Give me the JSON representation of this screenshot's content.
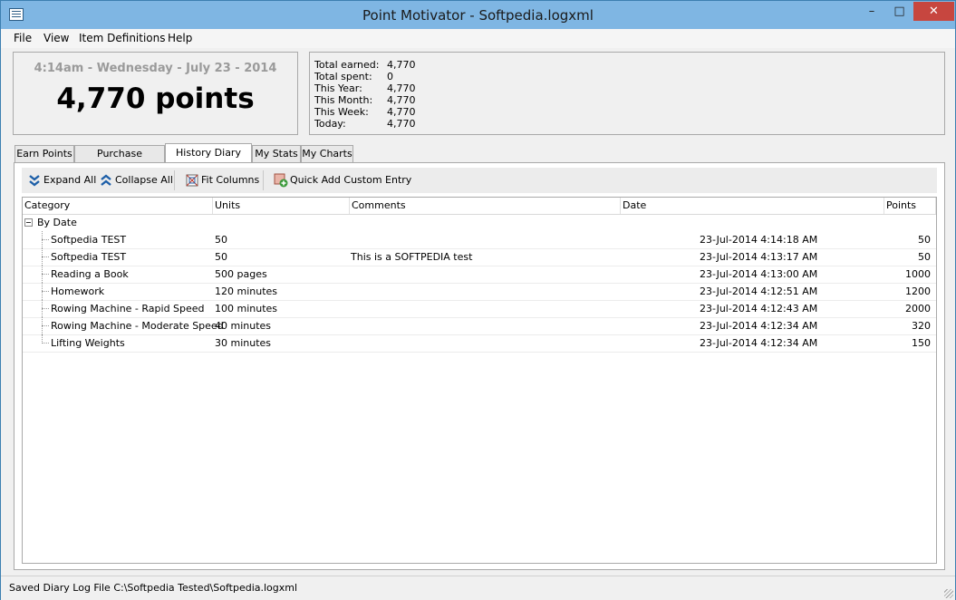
{
  "window": {
    "title": "Point Motivator - Softpedia.logxml",
    "minimize_glyph": "–",
    "maximize_glyph": "□",
    "close_glyph": "✕",
    "icon": "app-icon"
  },
  "menu": {
    "file": "File",
    "view": "View",
    "item_definitions": "Item Definitions",
    "help": "Help"
  },
  "summary": {
    "datetime": "4:14am - Wednesday - July 23 - 2014",
    "points": "4,770 points",
    "totals": [
      {
        "label": "Total earned:",
        "value": "4,770"
      },
      {
        "label": "Total spent:",
        "value": "0"
      },
      {
        "label": "This Year:",
        "value": "4,770"
      },
      {
        "label": "This Month:",
        "value": "4,770"
      },
      {
        "label": "This Week:",
        "value": "4,770"
      },
      {
        "label": "Today:",
        "value": "4,770"
      }
    ]
  },
  "tabs": [
    {
      "label": "Earn Points",
      "active": false
    },
    {
      "label": "Purchase Rewards",
      "active": false
    },
    {
      "label": "History Diary Log",
      "active": true
    },
    {
      "label": "My Stats",
      "active": false
    },
    {
      "label": "My Charts",
      "active": false
    }
  ],
  "toolbar": {
    "expand_all": "Expand All",
    "collapse_all": "Collapse All",
    "fit_columns": "Fit Columns",
    "quick_add": "Quick Add Custom Entry",
    "colors": {
      "chevron": "#1d5fa8",
      "add": "#3c9a3c"
    }
  },
  "grid": {
    "columns": [
      "Category",
      "Units",
      "Comments",
      "Date",
      "Points"
    ],
    "group": "By Date",
    "rows": [
      {
        "category": "Softpedia TEST",
        "units": "50",
        "comments": "",
        "date": "23-Jul-2014 4:14:18 AM",
        "points": "50"
      },
      {
        "category": "Softpedia TEST",
        "units": "50",
        "comments": "This is a SOFTPEDIA test",
        "date": "23-Jul-2014 4:13:17 AM",
        "points": "50"
      },
      {
        "category": "Reading a Book",
        "units": "500 pages",
        "comments": "",
        "date": "23-Jul-2014 4:13:00 AM",
        "points": "1000"
      },
      {
        "category": "Homework",
        "units": "120 minutes",
        "comments": "",
        "date": "23-Jul-2014 4:12:51 AM",
        "points": "1200"
      },
      {
        "category": "Rowing Machine - Rapid Speed",
        "units": "100 minutes",
        "comments": "",
        "date": "23-Jul-2014 4:12:43 AM",
        "points": "2000"
      },
      {
        "category": "Rowing Machine - Moderate Speed",
        "units": "40 minutes",
        "comments": "",
        "date": "23-Jul-2014 4:12:34 AM",
        "points": "320"
      },
      {
        "category": "Lifting Weights",
        "units": "30 minutes",
        "comments": "",
        "date": "23-Jul-2014 4:12:34 AM",
        "points": "150"
      }
    ]
  },
  "status": {
    "text": "Saved Diary Log File C:\\Softpedia Tested\\Softpedia.logxml"
  }
}
